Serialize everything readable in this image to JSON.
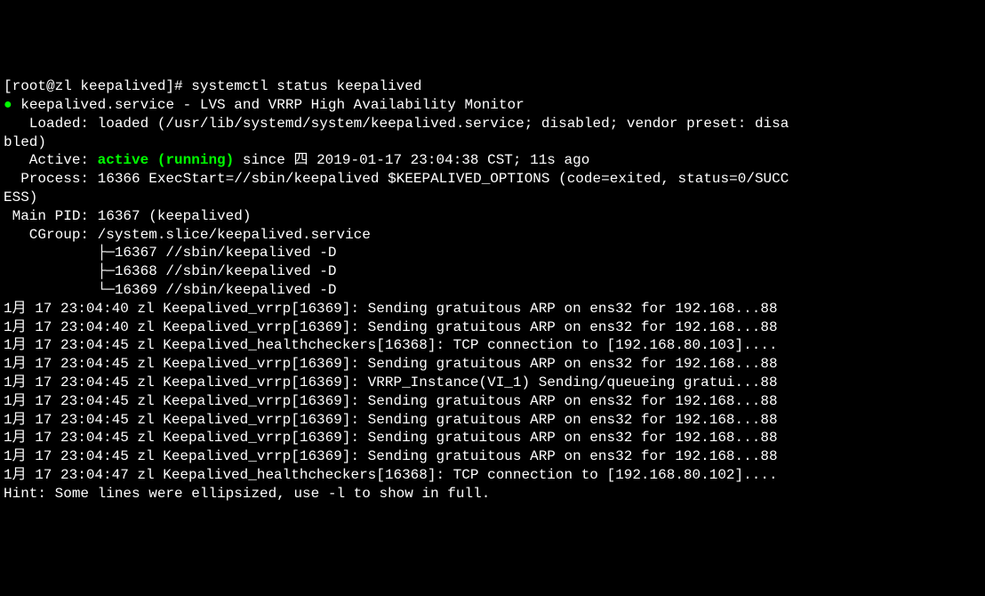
{
  "prompt": "[root@zl keepalived]# ",
  "command": "systemctl status keepalived",
  "bullet": "●",
  "service_line": " keepalived.service - LVS and VRRP High Availability Monitor",
  "loaded_line": "   Loaded: loaded (/usr/lib/systemd/system/keepalived.service; disabled; vendor preset: disa\nbled)",
  "active_prefix": "   Active: ",
  "active_status": "active (running)",
  "active_suffix": " since 四 2019-01-17 23:04:38 CST; 11s ago",
  "process_line": "  Process: 16366 ExecStart=//sbin/keepalived $KEEPALIVED_OPTIONS (code=exited, status=0/SUCC\nESS)",
  "mainpid_line": " Main PID: 16367 (keepalived)",
  "cgroup_line": "   CGroup: /system.slice/keepalived.service",
  "tree1": "           ├─16367 //sbin/keepalived -D",
  "tree2": "           ├─16368 //sbin/keepalived -D",
  "tree3": "           └─16369 //sbin/keepalived -D",
  "blank": "",
  "logs": [
    "1月 17 23:04:40 zl Keepalived_vrrp[16369]: Sending gratuitous ARP on ens32 for 192.168...88",
    "1月 17 23:04:40 zl Keepalived_vrrp[16369]: Sending gratuitous ARP on ens32 for 192.168...88",
    "1月 17 23:04:45 zl Keepalived_healthcheckers[16368]: TCP connection to [192.168.80.103]....",
    "1月 17 23:04:45 zl Keepalived_vrrp[16369]: Sending gratuitous ARP on ens32 for 192.168...88",
    "1月 17 23:04:45 zl Keepalived_vrrp[16369]: VRRP_Instance(VI_1) Sending/queueing gratui...88",
    "1月 17 23:04:45 zl Keepalived_vrrp[16369]: Sending gratuitous ARP on ens32 for 192.168...88",
    "1月 17 23:04:45 zl Keepalived_vrrp[16369]: Sending gratuitous ARP on ens32 for 192.168...88",
    "1月 17 23:04:45 zl Keepalived_vrrp[16369]: Sending gratuitous ARP on ens32 for 192.168...88",
    "1月 17 23:04:45 zl Keepalived_vrrp[16369]: Sending gratuitous ARP on ens32 for 192.168...88",
    "1月 17 23:04:47 zl Keepalived_healthcheckers[16368]: TCP connection to [192.168.80.102]...."
  ],
  "hint": "Hint: Some lines were ellipsized, use -l to show in full."
}
